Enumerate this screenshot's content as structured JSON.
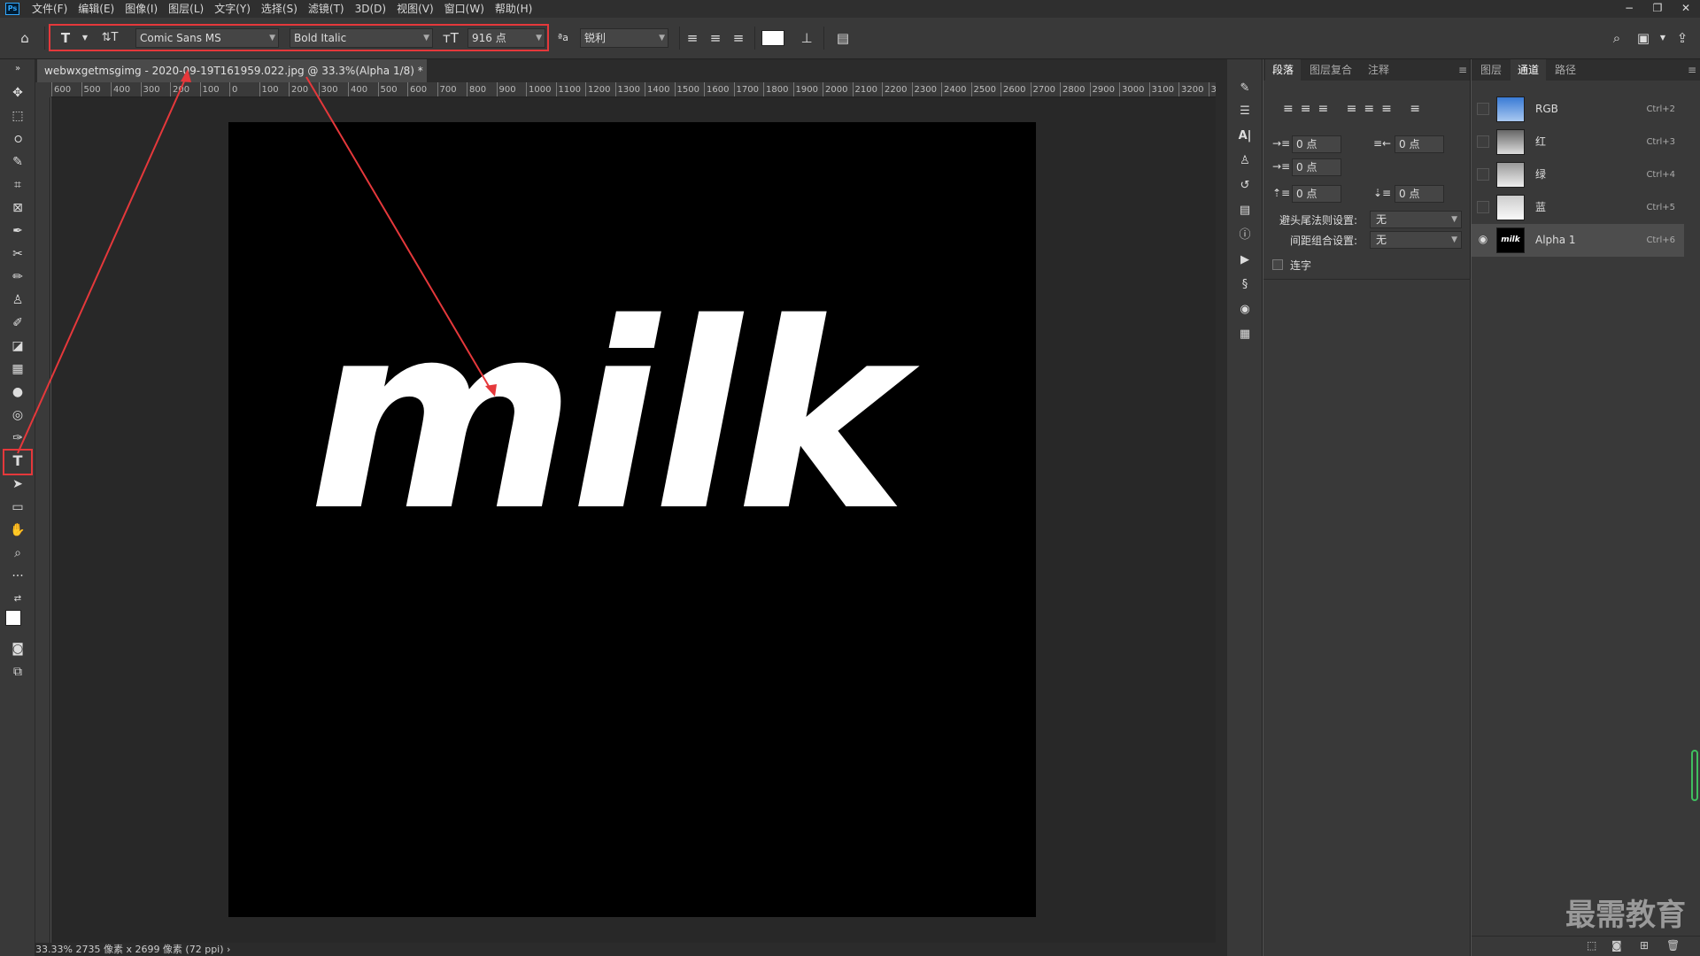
{
  "menubar": {
    "logo": "Ps",
    "items": [
      "文件(F)",
      "编辑(E)",
      "图像(I)",
      "图层(L)",
      "文字(Y)",
      "选择(S)",
      "滤镜(T)",
      "3D(D)",
      "视图(V)",
      "窗口(W)",
      "帮助(H)"
    ],
    "window_controls": [
      "−",
      "❐",
      "✕"
    ]
  },
  "options": {
    "font_family": "Comic Sans MS",
    "font_style": "Bold Italic",
    "font_size": "916 点",
    "antialias_icon": "ªa",
    "antialias": "锐利"
  },
  "document": {
    "tab_title": "webwxgetmsgimg - 2020-09-19T161959.022.jpg @ 33.3%(Alpha 1/8) *",
    "close": "×",
    "canvas_text": "milk",
    "zoom": "33.33%",
    "size_info": "2735 像素 x 2699 像素 (72 ppi)"
  },
  "ruler_labels": [
    "600",
    "500",
    "400",
    "300",
    "200",
    "100",
    "0",
    "100",
    "200",
    "300",
    "400",
    "500",
    "600",
    "700",
    "800",
    "900",
    "1000",
    "1100",
    "1200",
    "1300",
    "1400",
    "1500",
    "1600",
    "1700",
    "1800",
    "1900",
    "2000",
    "2100",
    "2200",
    "2300",
    "2400",
    "2500",
    "2600",
    "2700",
    "2800",
    "2900",
    "3000",
    "3100",
    "3200",
    "33"
  ],
  "paragraph_panel": {
    "tabs": [
      "段落",
      "图层复合",
      "注释"
    ],
    "indent_left": "0 点",
    "indent_right": "0 点",
    "indent_first": "0 点",
    "space_before": "0 点",
    "space_after": "0 点",
    "kinsoku_label": "避头尾法则设置:",
    "kinsoku_value": "无",
    "mojikumi_label": "间距组合设置:",
    "mojikumi_value": "无",
    "hyphenate_label": "连字"
  },
  "channels_panel": {
    "tabs": [
      "图层",
      "通道",
      "路径"
    ],
    "channels": [
      {
        "name": "RGB",
        "key": "Ctrl+2"
      },
      {
        "name": "红",
        "key": "Ctrl+3"
      },
      {
        "name": "绿",
        "key": "Ctrl+4"
      },
      {
        "name": "蓝",
        "key": "Ctrl+5"
      },
      {
        "name": "Alpha 1",
        "key": "Ctrl+6"
      }
    ],
    "alpha_thumb_text": "milk"
  },
  "watermark": "最需教育",
  "colors": {
    "accent_red": "#e5383b",
    "canvas_bg": "#000000",
    "panel_bg": "#393939"
  }
}
